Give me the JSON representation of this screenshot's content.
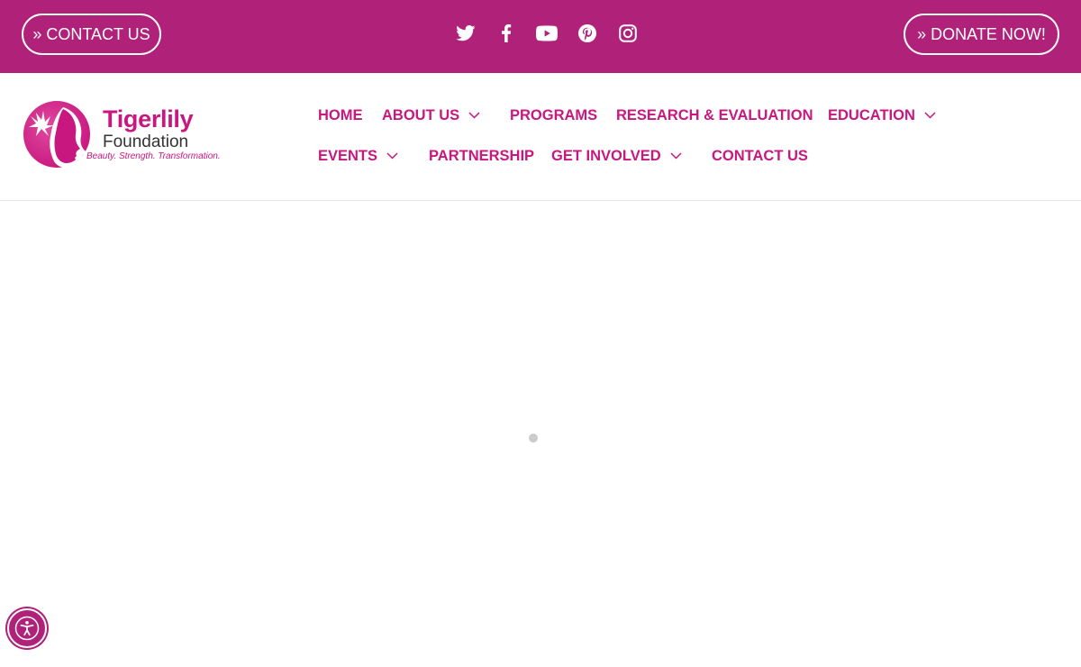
{
  "topbar": {
    "contact_label": "» CONTACT US",
    "donate_label": "» DONATE NOW!",
    "social_icons": [
      "twitter-icon",
      "facebook-icon",
      "youtube-icon",
      "pinterest-icon",
      "instagram-icon"
    ]
  },
  "logo": {
    "name": "Tigerlily",
    "sub": "Foundation",
    "tagline": "Beauty. Strength. Transformation."
  },
  "nav": {
    "home": "HOME",
    "about": "ABOUT US",
    "programs": "PROGRAMS",
    "research": "RESEARCH & EVALUATION",
    "education": "EDUCATION",
    "events": "EVENTS",
    "partnership": "PARTNERSHIP",
    "get_involved": "GET INVOLVED",
    "contact": "CONTACT US"
  },
  "colors": {
    "brand_magenta": "#b0217a",
    "nav_pink": "#c8177f",
    "loader_gray": "#cccccc"
  },
  "accessibility": {
    "icon": "accessibility-icon"
  }
}
